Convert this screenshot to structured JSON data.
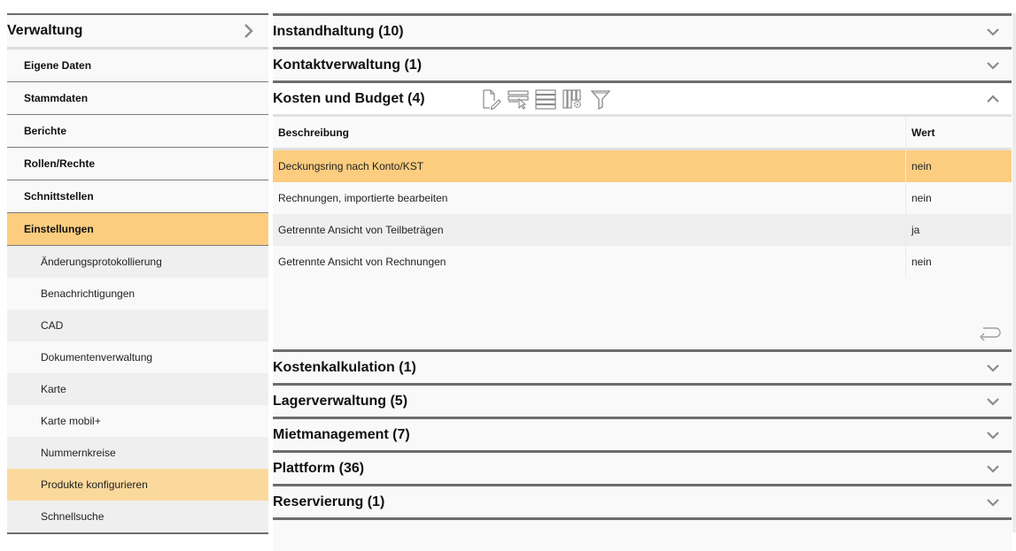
{
  "sidebar": {
    "header": {
      "label": "Verwaltung",
      "icon": "chevron-right-icon"
    },
    "items": [
      {
        "label": "Eigene Daten",
        "active": false
      },
      {
        "label": "Stammdaten",
        "active": false
      },
      {
        "label": "Berichte",
        "active": false
      },
      {
        "label": "Rollen/Rechte",
        "active": false
      },
      {
        "label": "Schnittstellen",
        "active": false
      },
      {
        "label": "Einstellungen",
        "active": true
      }
    ],
    "subitems": [
      {
        "label": "Änderungsprotokollierung",
        "active": false
      },
      {
        "label": "Benachrichtigungen",
        "active": false
      },
      {
        "label": "CAD",
        "active": false
      },
      {
        "label": "Dokumentenverwaltung",
        "active": false
      },
      {
        "label": "Karte",
        "active": false
      },
      {
        "label": "Karte mobil+",
        "active": false
      },
      {
        "label": "Nummernkreise",
        "active": false
      },
      {
        "label": "Produkte konfigurieren",
        "active": true
      },
      {
        "label": "Schnellsuche",
        "active": false
      }
    ]
  },
  "accordion": {
    "sections_before": [
      {
        "title": "Instandhaltung (10)",
        "icon": "chevron-down-icon"
      },
      {
        "title": "Kontaktverwaltung (1)",
        "icon": "chevron-down-icon"
      }
    ],
    "open_section": {
      "title": "Kosten und Budget (4)",
      "icon": "chevron-up-icon",
      "toolbar": [
        {
          "name": "edit-document-icon",
          "tooltip": ""
        },
        {
          "name": "select-row-icon",
          "tooltip": ""
        },
        {
          "name": "list-rows-icon",
          "tooltip": ""
        },
        {
          "name": "column-settings-icon",
          "tooltip": ""
        },
        {
          "name": "filter-icon",
          "tooltip": ""
        }
      ],
      "table": {
        "columns": [
          "Beschreibung",
          "Wert"
        ],
        "rows": [
          {
            "description": "Deckungsring nach Konto/KST",
            "value": "nein",
            "selected": true
          },
          {
            "description": "Rechnungen, importierte bearbeiten",
            "value": "nein",
            "selected": false
          },
          {
            "description": "Getrennte Ansicht von Teilbeträgen",
            "value": "ja",
            "selected": false
          },
          {
            "description": "Getrennte Ansicht von Rechnungen",
            "value": "nein",
            "selected": false
          }
        ]
      },
      "back_icon": "return-arrow-icon"
    },
    "sections_after": [
      {
        "title": "Kostenkalkulation (1)",
        "icon": "chevron-down-icon"
      },
      {
        "title": "Lagerverwaltung (5)",
        "icon": "chevron-down-icon"
      },
      {
        "title": "Mietmanagement (7)",
        "icon": "chevron-down-icon"
      },
      {
        "title": "Plattform (36)",
        "icon": "chevron-down-icon"
      },
      {
        "title": "Reservierung (1)",
        "icon": "chevron-down-icon"
      }
    ]
  },
  "colors": {
    "highlight": "#fccd7f",
    "highlight_light": "#fbd99d",
    "divider": "#6d6d6d",
    "icon_gray": "#8a8a8a"
  }
}
